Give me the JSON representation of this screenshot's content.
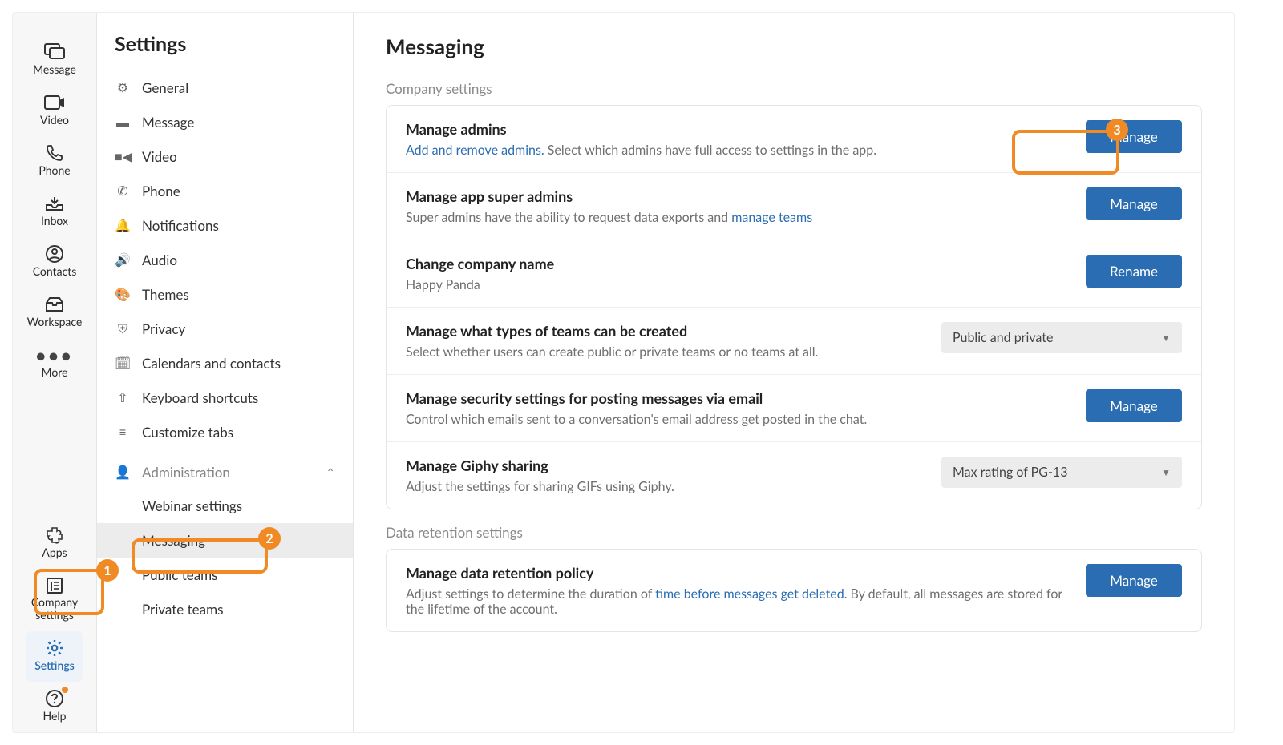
{
  "rail": {
    "top": [
      {
        "label": "Message",
        "icon": "chat"
      },
      {
        "label": "Video",
        "icon": "video"
      },
      {
        "label": "Phone",
        "icon": "phone"
      },
      {
        "label": "Inbox",
        "icon": "inbox"
      },
      {
        "label": "Contacts",
        "icon": "contacts"
      },
      {
        "label": "Workspace",
        "icon": "workspace"
      },
      {
        "label": "More",
        "icon": "more"
      }
    ],
    "bottom": [
      {
        "label": "Apps",
        "icon": "apps"
      },
      {
        "label": "Company settings",
        "icon": "company",
        "two_line": true
      },
      {
        "label": "Settings",
        "icon": "gear",
        "selected": true
      },
      {
        "label": "Help",
        "icon": "help",
        "dot": true
      }
    ]
  },
  "settings_nav": {
    "title": "Settings",
    "items": [
      {
        "label": "General",
        "icon": "gear"
      },
      {
        "label": "Message",
        "icon": "message"
      },
      {
        "label": "Video",
        "icon": "videocam"
      },
      {
        "label": "Phone",
        "icon": "handset"
      },
      {
        "label": "Notifications",
        "icon": "bell"
      },
      {
        "label": "Audio",
        "icon": "speaker"
      },
      {
        "label": "Themes",
        "icon": "palette"
      },
      {
        "label": "Privacy",
        "icon": "shield"
      },
      {
        "label": "Calendars and contacts",
        "icon": "calendar"
      },
      {
        "label": "Keyboard shortcuts",
        "icon": "keyboard"
      },
      {
        "label": "Customize tabs",
        "icon": "tabs"
      }
    ],
    "group": {
      "label": "Administration",
      "items": [
        {
          "label": "Webinar settings"
        },
        {
          "label": "Messaging",
          "selected": true
        },
        {
          "label": "Public teams"
        },
        {
          "label": "Private teams"
        }
      ]
    }
  },
  "main": {
    "title": "Messaging",
    "section1": "Company settings",
    "section2": "Data retention settings",
    "rows": {
      "manage_admins": {
        "title": "Manage admins",
        "link": "Add and remove admins.",
        "desc_tail": " Select which admins have full access to settings in the app.",
        "btn": "Manage"
      },
      "super_admins": {
        "title": "Manage app super admins",
        "desc_pre": "Super admins have the ability to request data exports and ",
        "link": "manage teams",
        "btn": "Manage"
      },
      "company_name": {
        "title": "Change company name",
        "value": "Happy Panda",
        "btn": "Rename"
      },
      "team_types": {
        "title": "Manage what types of teams can be created",
        "desc": "Select whether users can create public or private teams or no teams at all.",
        "select": "Public and private"
      },
      "email_security": {
        "title": "Manage security settings for posting messages via email",
        "desc": "Control which emails sent to a conversation's email address get posted in the chat.",
        "btn": "Manage"
      },
      "giphy": {
        "title": "Manage Giphy sharing",
        "desc": "Adjust the settings for sharing GIFs using Giphy.",
        "select": "Max rating of PG-13"
      },
      "retention": {
        "title": "Manage data retention policy",
        "desc_pre": "Adjust settings to determine the duration of ",
        "link": "time before messages get deleted",
        "desc_post": ". By default, all messages are stored for the lifetime of the account.",
        "btn": "Manage"
      }
    }
  },
  "annotations": {
    "b1": "1",
    "b2": "2",
    "b3": "3"
  }
}
